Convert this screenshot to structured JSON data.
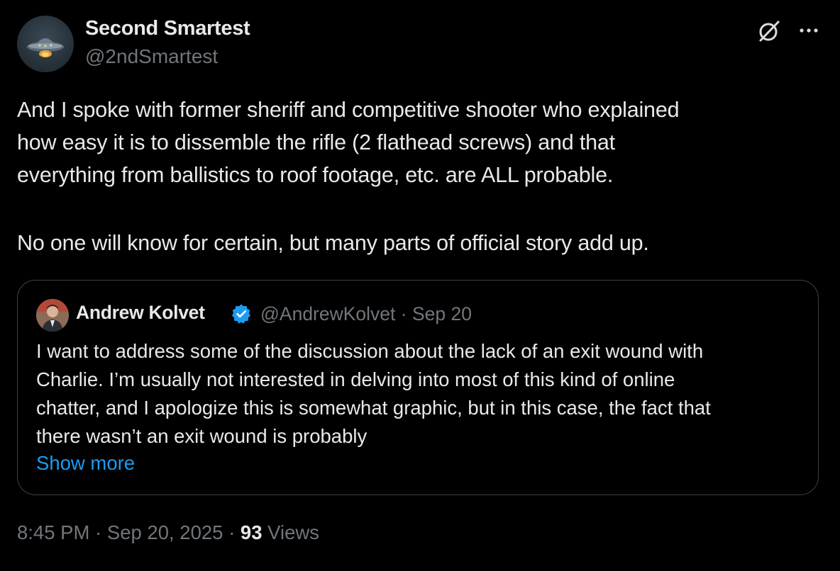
{
  "author": {
    "name": "Second Smartest",
    "handle": "@2ndSmartest",
    "avatar_icon": "ufo-avatar"
  },
  "header_actions": {
    "grok_icon": "grok-icon",
    "more_icon": "more-icon"
  },
  "tweet": {
    "lines": [
      "And I spoke with former sheriff and competitive shooter who explained",
      "how easy it is to dissemble the rifle (2 flathead screws) and that",
      "everything from ballistics to roof footage, etc. are ALL probable."
    ],
    "line2": "No one will know for certain, but many parts of official story add up."
  },
  "quote": {
    "name": "Andrew Kolvet",
    "verified_color": "#1d9bf0",
    "meta": "@AndrewKolvet · Sep 20",
    "lines": [
      "I want to address some of the discussion about the lack of an exit wound with",
      "Charlie. I’m usually not interested in delving into most of this kind of online",
      "chatter, and I apologize this is somewhat graphic, but in this case, the fact that",
      "there wasn’t an exit wound is probably"
    ],
    "show_more": "Show more"
  },
  "footer": {
    "time": "8:45 PM · Sep 20, 2025 · ",
    "views_count": "93",
    "views_label": " Views"
  },
  "colors": {
    "background": "#000000",
    "text": "#e7e9ea",
    "secondary": "#71767b",
    "link": "#1d9bf0",
    "border": "#3e4144"
  }
}
